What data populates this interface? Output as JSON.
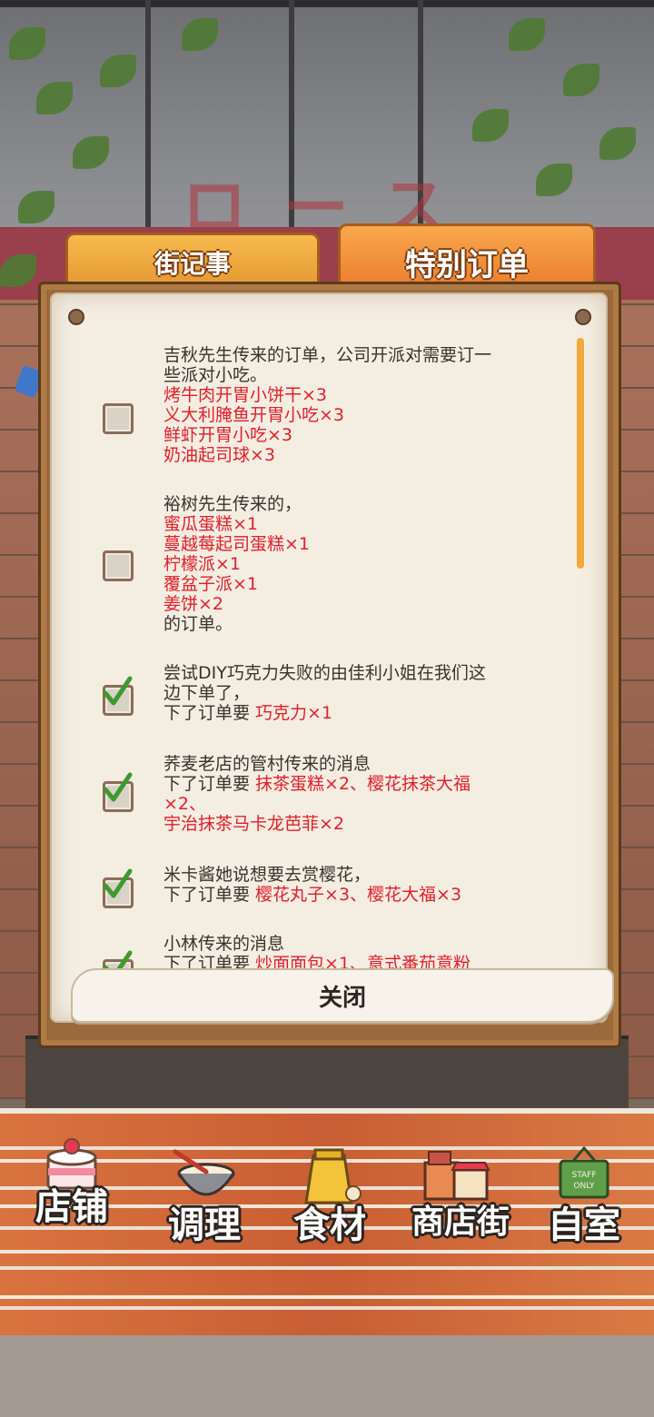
{
  "background": {
    "sign_text": "ロース"
  },
  "tabs": [
    {
      "label": "街记事",
      "active": false
    },
    {
      "label": "特别订单",
      "active": true
    }
  ],
  "orders": [
    {
      "checked": false,
      "lines": [
        {
          "text": "吉秋先生传来的订单，公司开派对需要订一",
          "red": false
        },
        {
          "text": "些派对小吃。",
          "red": false
        },
        {
          "text": "烤牛肉开胃小饼干×3",
          "red": true
        },
        {
          "text": "义大利腌鱼开胃小吃×3",
          "red": true
        },
        {
          "text": "鲜虾开胃小吃×3",
          "red": true
        },
        {
          "text": "奶油起司球×3",
          "red": true
        }
      ]
    },
    {
      "checked": false,
      "lines": [
        {
          "text": "裕树先生传来的，",
          "red": false
        },
        {
          "text": "蜜瓜蛋糕×1",
          "red": true
        },
        {
          "text": "蔓越莓起司蛋糕×1",
          "red": true
        },
        {
          "text": "柠檬派×1",
          "red": true
        },
        {
          "text": "覆盆子派×1",
          "red": true
        },
        {
          "text": "姜饼×2",
          "red": true
        },
        {
          "text": "的订单。",
          "red": false
        }
      ]
    },
    {
      "checked": true,
      "lines": [
        {
          "text": "尝试DIY巧克力失败的由佳利小姐在我们这",
          "red": false
        },
        {
          "text": "边下单了，",
          "red": false
        },
        {
          "prefix": "下了订单要 ",
          "text": "巧克力×1",
          "red": true
        }
      ]
    },
    {
      "checked": true,
      "lines": [
        {
          "text": "荞麦老店的管村传来的消息",
          "red": false
        },
        {
          "prefix": "下了订单要 ",
          "text": "抹茶蛋糕×2、樱花抹茶大福",
          "red": true
        },
        {
          "text": "×2、",
          "red": true
        },
        {
          "text": "宇治抹茶马卡龙芭菲×2",
          "red": true
        }
      ]
    },
    {
      "checked": true,
      "lines": [
        {
          "text": "米卡酱她说想要去赏樱花，",
          "red": false
        },
        {
          "prefix": "下了订单要 ",
          "text": "樱花丸子×3、樱花大福×3",
          "red": true
        }
      ]
    },
    {
      "checked": true,
      "lines": [
        {
          "text": "小林传来的消息",
          "red": false
        },
        {
          "prefix": "下了订单要 ",
          "text": "炒面面包×1、意式番茄意粉",
          "red": true
        }
      ]
    }
  ],
  "close_label": "关闭",
  "nav": [
    {
      "label": "店铺",
      "icon": "cake-icon"
    },
    {
      "label": "调理",
      "icon": "mixing-bowl-icon"
    },
    {
      "label": "食材",
      "icon": "ingredient-bag-icon"
    },
    {
      "label": "商店街",
      "icon": "shop-street-icon"
    },
    {
      "label": "自室",
      "icon": "staff-only-door-icon"
    }
  ],
  "staff_sign": "STAFF ONLY",
  "colors": {
    "accent_orange": "#e9772a",
    "order_red": "#e0202a",
    "scrollbar": "#f0a93a"
  }
}
